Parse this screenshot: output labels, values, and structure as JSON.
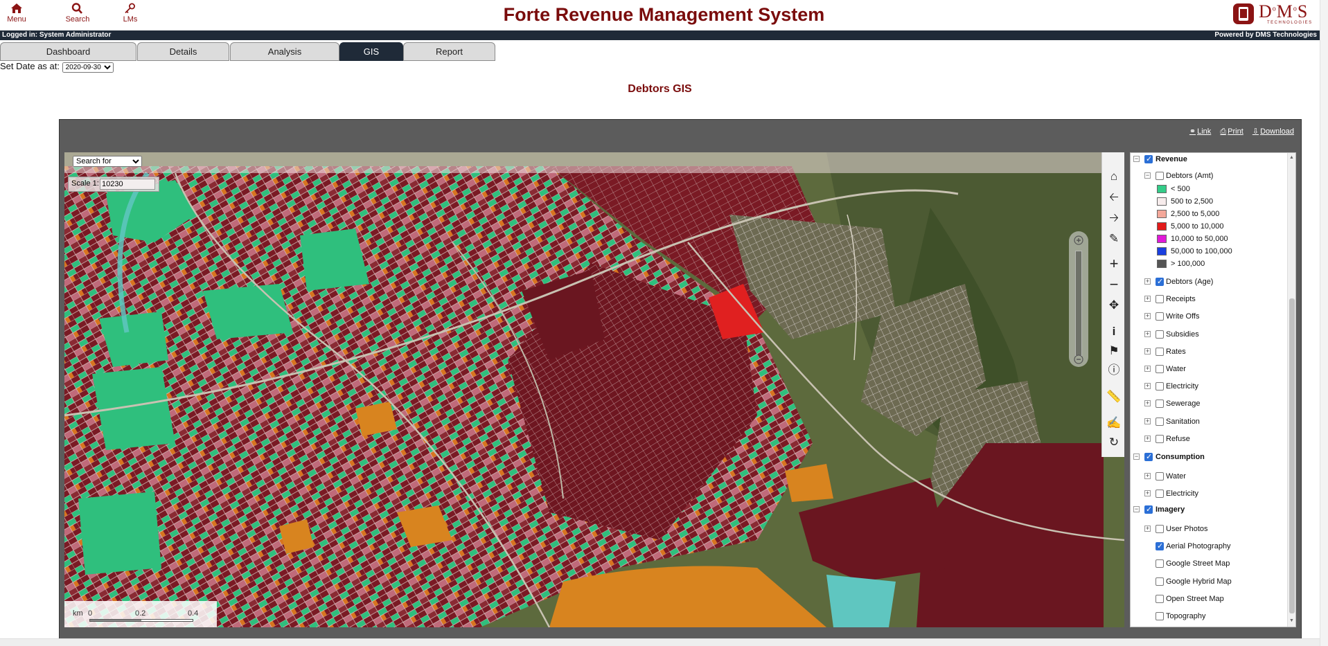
{
  "header": {
    "title": "Forte Revenue Management System",
    "nav": [
      {
        "label": "Menu",
        "icon": "home-icon"
      },
      {
        "label": "Search",
        "icon": "search-icon"
      },
      {
        "label": "LMs",
        "icon": "key-icon"
      }
    ],
    "logo": {
      "text": "D⁰M⁰S",
      "sub": "TECHNOLOGIES"
    }
  },
  "status": {
    "logged_in": "Logged in: System Administrator",
    "powered_by": "Powered by DMS Technologies"
  },
  "tabs": [
    {
      "label": "Dashboard",
      "active": false
    },
    {
      "label": "Details",
      "active": false
    },
    {
      "label": "Analysis",
      "active": false
    },
    {
      "label": "GIS",
      "active": true
    },
    {
      "label": "Report",
      "active": false
    }
  ],
  "date": {
    "label": "Set Date as at:",
    "value": "2020-09-30"
  },
  "page_title": "Debtors GIS",
  "frame_links": {
    "link": "Link",
    "print": "Print",
    "download": "Download"
  },
  "map": {
    "search_placeholder": "Search for",
    "scale_label": "Scale 1:",
    "scale_value": "10230",
    "scalebar": {
      "unit": "km",
      "ticks": [
        "0",
        "0.2",
        "0.4"
      ]
    },
    "tools": [
      "home-icon",
      "back-arrow-icon",
      "forward-arrow-icon",
      "zoom-box-icon",
      "zoom-in-icon",
      "zoom-out-icon",
      "pan-icon",
      "info-icon",
      "identify-icon",
      "tooltip-icon",
      "measure-icon",
      "fill-icon",
      "refresh-icon"
    ]
  },
  "layers": {
    "revenue": {
      "label": "Revenue",
      "debtors_amt": "Debtors (Amt)",
      "legend": [
        {
          "label": "< 500",
          "color": "#33cc88"
        },
        {
          "label": "500 to 2,500",
          "color": "#f7ecec"
        },
        {
          "label": "2,500 to 5,000",
          "color": "#f4a89a"
        },
        {
          "label": "5,000 to 10,000",
          "color": "#e21a1a"
        },
        {
          "label": "10,000 to 50,000",
          "color": "#e01ad8"
        },
        {
          "label": "50,000 to 100,000",
          "color": "#1a3fe0"
        },
        {
          "label": "> 100,000",
          "color": "#555555"
        }
      ],
      "items": [
        "Debtors (Age)",
        "Receipts",
        "Write Offs",
        "Subsidies",
        "Rates",
        "Water",
        "Electricity",
        "Sewerage",
        "Sanitation",
        "Refuse"
      ]
    },
    "consumption": {
      "label": "Consumption",
      "items": [
        "Water",
        "Electricity"
      ]
    },
    "imagery": {
      "label": "Imagery",
      "items": [
        "User Photos",
        "Aerial Photography",
        "Google Street Map",
        "Google Hybrid Map",
        "Open Street Map",
        "Topography"
      ]
    }
  }
}
